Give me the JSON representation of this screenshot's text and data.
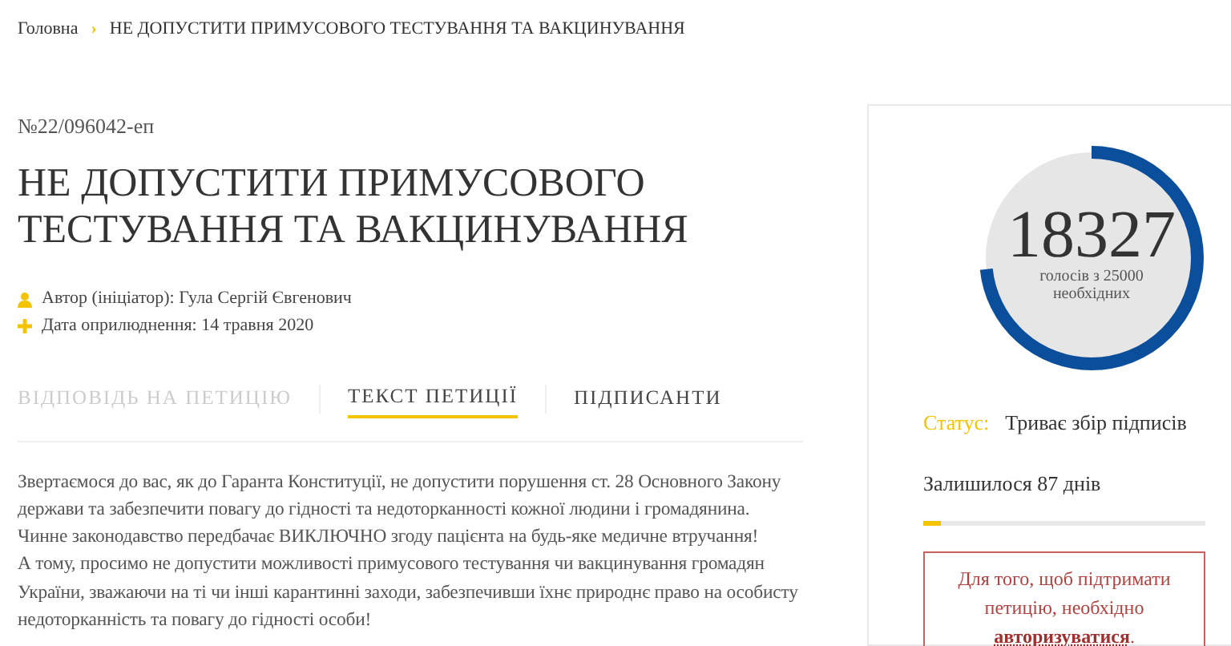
{
  "breadcrumb": {
    "home": "Головна",
    "separator": "›",
    "current": "НЕ ДОПУСТИТИ ПРИМУСОВОГО ТЕСТУВАННЯ ТА ВАКЦИНУВАННЯ"
  },
  "petition": {
    "number": "№22/096042-еп",
    "title": "НЕ ДОПУСТИТИ ПРИМУСОВОГО ТЕСТУВАННЯ ТА ВАКЦИНУВАННЯ",
    "meta": [
      {
        "kind": "author",
        "text": "Автор (ініціатор): Гула Сергій Євгенович"
      },
      {
        "kind": "date",
        "text": "Дата оприлюднення: 14 травня 2020"
      }
    ]
  },
  "tabs": [
    {
      "label": "ВІДПОВІДЬ НА ПЕТИЦІЮ",
      "selected": false,
      "disabled": true
    },
    {
      "label": "ТЕКСТ ПЕТИЦІЇ",
      "selected": true,
      "disabled": false
    },
    {
      "label": "ПІДПИСАНТИ",
      "selected": false,
      "disabled": false
    }
  ],
  "body": [
    "Звертаємося до вас, як до Гаранта Конституції, не допустити порушення ст. 28 Основного Закону держави та забезпечити повагу до гідності та недоторканності кожної людини і громадянина.",
    "Чинне законодавство передбачає ВИКЛЮЧНО згоду пацієнта на будь-яке медичне втручання!",
    "А тому, просимо не допустити можливості примусового тестування чи вакцинування громадян України, зважаючи на ті чи інші карантинні заходи, забезпечивши їхнє природнє право на особисту недоторканність та повагу до гідності особи!"
  ],
  "sidebar": {
    "votes": {
      "count": "18327",
      "caption_line_1": "голосів з 25000",
      "caption_line_2": "необхідних",
      "level": 0.733
    },
    "status": {
      "label": "Статус:",
      "value": "Триває збір підписів"
    },
    "remaining": {
      "text": "Залишилося 87 днів",
      "level": 0.06
    },
    "login_notice": {
      "text": "Для того, щоб підтримати петицію, необхідно",
      "link": "авторизуватися",
      "after": "."
    }
  }
}
